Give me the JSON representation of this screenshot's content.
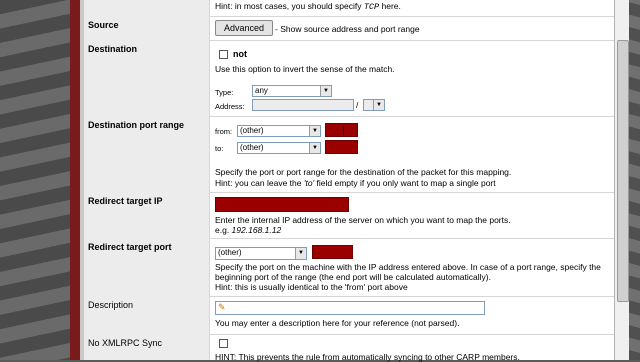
{
  "top": {
    "hint": "Hint: in most cases, you should specify ",
    "hint_em": "TCP",
    "hint_end": " here."
  },
  "source": {
    "label": "Source",
    "button": "Advanced",
    "desc": " - Show source address and port range"
  },
  "destination": {
    "label": "Destination",
    "not_label": "not",
    "desc": "Use this option to invert the sense of the match.",
    "type_label": "Type:",
    "type_value": "any",
    "address_label": "Address:",
    "slash": "/"
  },
  "dest_port": {
    "label": "Destination port range",
    "from_label": "from:",
    "from_value": "(other)",
    "to_label": "to:",
    "to_value": "(other)",
    "desc1": "Specify the port or port range for the destination of the packet for this mapping.",
    "desc2a": "Hint: you can leave the ",
    "desc2em": "'to'",
    "desc2b": " field empty if you only want to map a single port"
  },
  "redirect_ip": {
    "label": "Redirect target IP",
    "desc": "Enter the internal IP address of the server on which you want to map the ports.",
    "example_prefix": "e.g. ",
    "example": "192.168.1.12"
  },
  "redirect_port": {
    "label": "Redirect target port",
    "value": "(other)",
    "desc1": "Specify the port on the machine with the IP address entered above. In case of a port range, specify the",
    "desc2": "beginning port of the range (the end port will be calculated automatically).",
    "desc3": "Hint: this is usually identical to the 'from' port above"
  },
  "description": {
    "label": "Description",
    "desc": "You may enter a description here for your reference (not parsed)."
  },
  "xmlrpc": {
    "label": "No XMLRPC Sync",
    "desc": "HINT: This prevents the rule from automatically syncing to other CARP members."
  },
  "colors": {
    "accent_red": "#9b0000",
    "frame_red": "#7a1a1a"
  }
}
